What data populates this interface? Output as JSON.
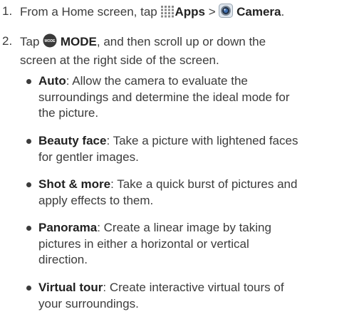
{
  "steps": [
    {
      "number": "1.",
      "prefix": "From a Home screen, tap",
      "apps_icon": "apps-grid-icon",
      "apps_label": "Apps",
      "separator": ">",
      "camera_icon": "camera-app-icon",
      "camera_label": "Camera",
      "suffix": "."
    },
    {
      "number": "2.",
      "prefix": "Tap",
      "mode_icon": "mode-button-icon",
      "mode_icon_text": "MODE",
      "mode_label": "MODE",
      "suffix_line1": ", and then scroll up or down the",
      "line2": "screen at the right side of the screen."
    }
  ],
  "modes": [
    {
      "name": "Auto",
      "lines": [
        ": Allow the camera to evaluate the",
        "surroundings and determine the ideal mode for",
        "the picture."
      ]
    },
    {
      "name": "Beauty face",
      "lines": [
        ": Take a picture with lightened faces",
        "for gentler images."
      ]
    },
    {
      "name": "Shot & more",
      "lines": [
        ": Take a quick burst of pictures and",
        "apply effects to them."
      ]
    },
    {
      "name": "Panorama",
      "lines": [
        ": Create a linear image by taking",
        "pictures in either a horizontal or vertical",
        "direction."
      ]
    },
    {
      "name": "Virtual tour",
      "lines": [
        ": Create interactive virtual tours of",
        "your surroundings."
      ]
    }
  ]
}
